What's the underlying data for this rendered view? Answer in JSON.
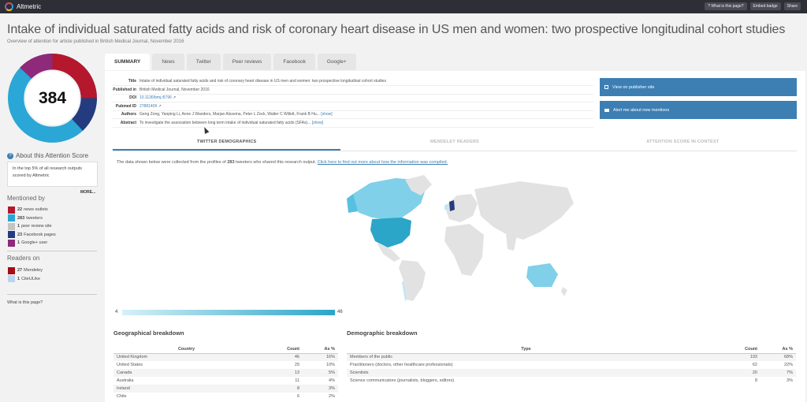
{
  "app": {
    "name": "Altmetric"
  },
  "top_buttons": [
    "? What is this page?",
    "Embed badge",
    "Share"
  ],
  "header": {
    "title": "Intake of individual saturated fatty acids and risk of coronary heart disease in US men and women: two prospective longitudinal cohort studies",
    "subtitle": "Overview of attention for article published in British Medical Journal, November 2016"
  },
  "score": {
    "value": "384",
    "about_label": "About this Attention Score",
    "summary": "In the top 5% of all research outputs scored by Altmetric",
    "more_label": "MORE..."
  },
  "mentioned_by": {
    "heading": "Mentioned by",
    "items": [
      {
        "count": "22",
        "label": "news outlets",
        "color": "#b5172c"
      },
      {
        "count": "283",
        "label": "tweeters",
        "color": "#2aa7d6"
      },
      {
        "count": "1",
        "label": "peer review site",
        "color": "#c4c4c4"
      },
      {
        "count": "23",
        "label": "Facebook pages",
        "color": "#253b80"
      },
      {
        "count": "1",
        "label": "Google+ user",
        "color": "#8e2a79"
      }
    ]
  },
  "readers_on": {
    "heading": "Readers on",
    "items": [
      {
        "count": "27",
        "label": "Mendeley",
        "color": "#a30d13"
      },
      {
        "count": "1",
        "label": "CiteULike",
        "color": "#b9d4f2"
      }
    ]
  },
  "what_page_link": "What is this page?",
  "tabs": [
    "SUMMARY",
    "News",
    "Twitter",
    "Peer reviews",
    "Facebook",
    "Google+"
  ],
  "metadata": [
    {
      "key": "Title",
      "value": "Intake of individual saturated fatty acids and risk of coronary heart disease in US men and women: two prospective longitudinal cohort studies",
      "extra": ""
    },
    {
      "key": "Published in",
      "value": "British Medical Journal, November 2016",
      "extra": ""
    },
    {
      "key": "DOI",
      "value": "10.1136/bmj.i5796",
      "extra": ""
    },
    {
      "key": "Pubmed ID",
      "value": "27881409",
      "extra": ""
    },
    {
      "key": "Authors",
      "value": "Geng Zong, Yanping Li, Anne J Wanders, Marjan Alssema, Peter L Zock, Walter C Willett, Frank B Hu...",
      "extra": "[show]"
    },
    {
      "key": "Abstract",
      "value": "To investigate the association between long term intake of individual saturated fatty acids (SFAs)...",
      "extra": "[show]"
    }
  ],
  "actions": {
    "publisher": "View on publisher site",
    "alert": "Alert me about new mentions"
  },
  "subtabs": [
    "TWITTER DEMOGRAPHICS",
    "MENDELEY READERS",
    "ATTENTION SCORE IN CONTEXT"
  ],
  "twitter_note": {
    "prefix": "The data shown below were collected from the profiles of",
    "count": "283",
    "suffix": "tweeters who shared this research output.",
    "link": "Click here to find out more about how the information was compiled."
  },
  "map_scale": {
    "min": "4",
    "max": "46",
    "min_color": "#d6f1f8",
    "max_color": "#2ba5c8"
  },
  "geo": {
    "heading": "Geographical breakdown",
    "columns": [
      "Country",
      "Count",
      "As %"
    ],
    "rows": [
      [
        "United Kingdom",
        "46",
        "16%"
      ],
      [
        "United States",
        "29",
        "10%"
      ],
      [
        "Canada",
        "13",
        "5%"
      ],
      [
        "Australia",
        "11",
        "4%"
      ],
      [
        "Ireland",
        "8",
        "3%"
      ],
      [
        "Chile",
        "6",
        "2%"
      ]
    ]
  },
  "demo": {
    "heading": "Demographic breakdown",
    "columns": [
      "Type",
      "Count",
      "As %"
    ],
    "rows": [
      [
        "Members of the public",
        "193",
        "68%"
      ],
      [
        "Practitioners (doctors, other healthcare professionals)",
        "62",
        "22%"
      ],
      [
        "Scientists",
        "20",
        "7%"
      ],
      [
        "Science communicators (journalists, bloggers, editors)",
        "8",
        "3%"
      ]
    ]
  }
}
